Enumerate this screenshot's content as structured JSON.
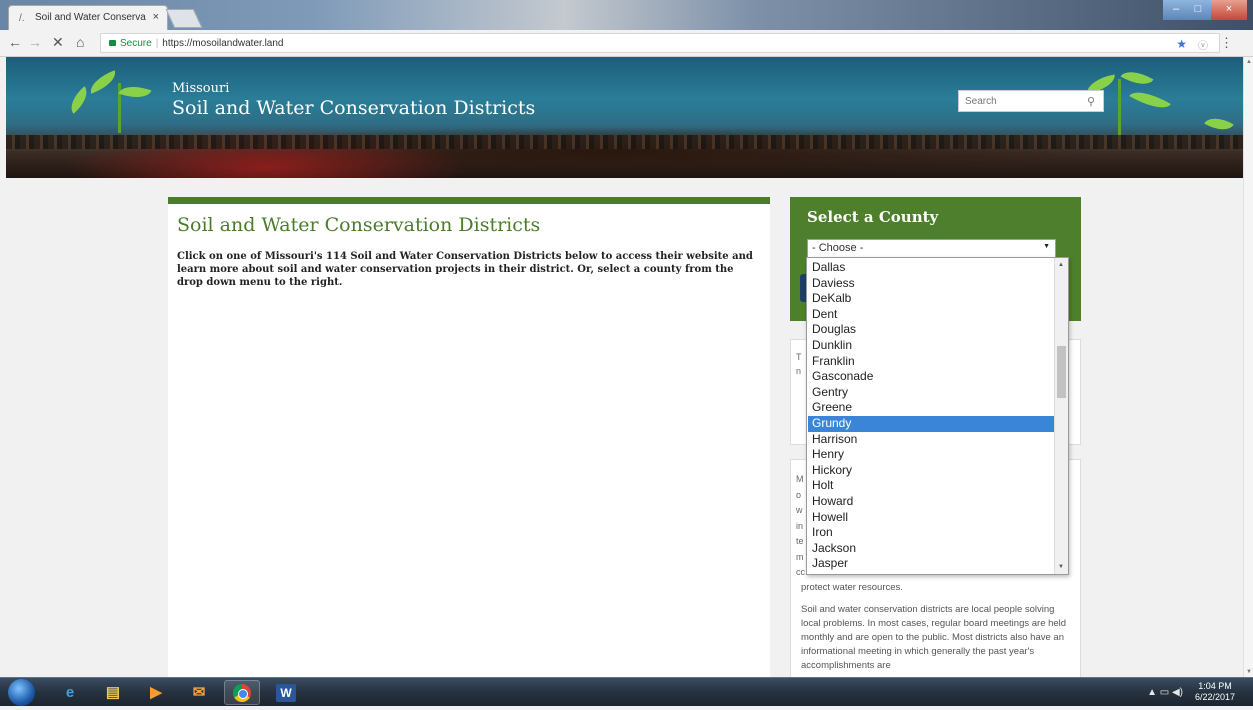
{
  "browser": {
    "tab_title": "Soil and Water Conserva",
    "tab_close": "×",
    "secure_label": "Secure",
    "url": "https://mosoilandwater.land"
  },
  "site": {
    "subtitle": "Missouri",
    "title": "Soil and Water Conservation Districts",
    "search_placeholder": "Search"
  },
  "main": {
    "heading": "Soil and Water Conservation Districts",
    "intro": "Click on one of Missouri's 114 Soil and Water Conservation Districts below to access their website and learn more about soil and water conservation projects in their district. Or, select a county from the drop down menu to the right."
  },
  "sidebar": {
    "county_heading": "Select a County",
    "select_value": "- Choose -",
    "card1_peek": "T\nn",
    "card2_peek": "M\no\nw\nin\nte\nm\ncc",
    "card2_tail": "protect water resources.",
    "card2_paragraph": "Soil and water conservation districts are local people solving local problems. In most cases, regular board meetings are held monthly and are open to the public. Most districts also have an informational meeting in which generally the past year's accomplishments are"
  },
  "dropdown": {
    "options": [
      "Dallas",
      "Daviess",
      "DeKalb",
      "Dent",
      "Douglas",
      "Dunklin",
      "Franklin",
      "Gasconade",
      "Gentry",
      "Greene",
      "Grundy",
      "Harrison",
      "Henry",
      "Hickory",
      "Holt",
      "Howard",
      "Howell",
      "Iron",
      "Jackson",
      "Jasper"
    ],
    "selected": "Grundy"
  },
  "taskbar": {
    "clock_time": "1:04 PM",
    "clock_date": "6/22/2017"
  },
  "colors": {
    "accent_green": "#4a7c2a",
    "selected_blue": "#3b85d9"
  }
}
